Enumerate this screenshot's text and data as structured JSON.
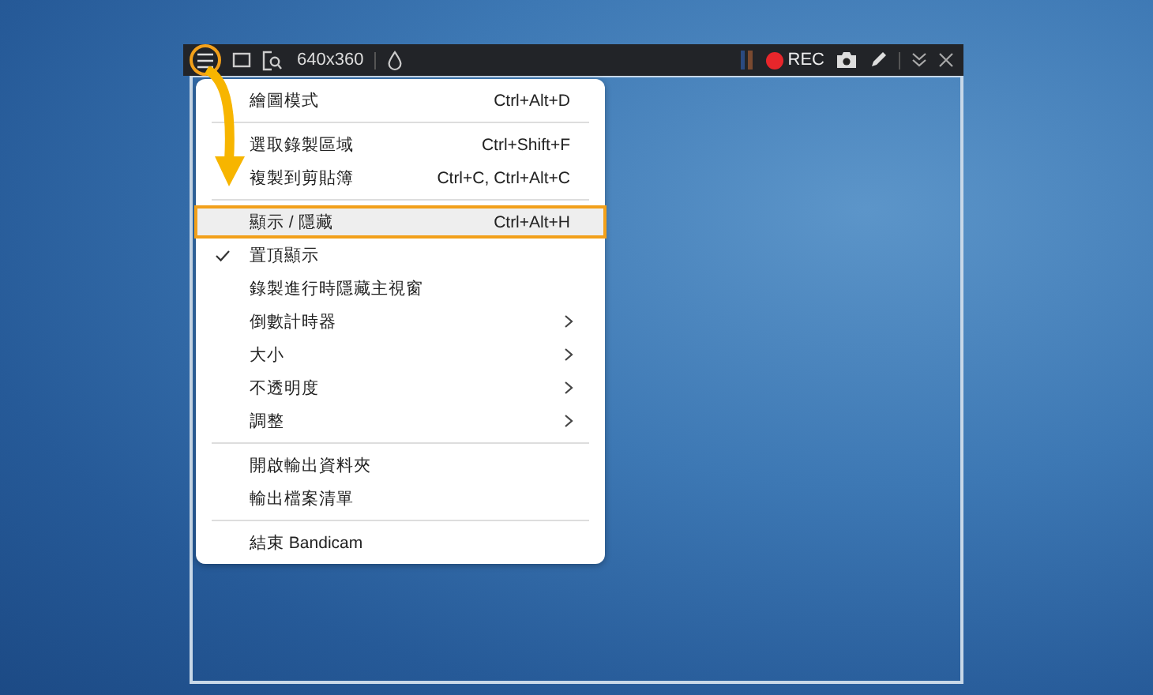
{
  "toolbar": {
    "menu_button_selected": true,
    "resolution": "640x360",
    "rec_label": "REC"
  },
  "menu": {
    "items": [
      {
        "kind": "item",
        "label": "繪圖模式",
        "shortcut": "Ctrl+Alt+D",
        "checked": false,
        "submenu": false,
        "selected": false
      },
      {
        "kind": "separator"
      },
      {
        "kind": "item",
        "label": "選取錄製區域",
        "shortcut": "Ctrl+Shift+F",
        "checked": false,
        "submenu": false,
        "selected": false
      },
      {
        "kind": "item",
        "label": "複製到剪貼簿",
        "shortcut": "Ctrl+C, Ctrl+Alt+C",
        "checked": false,
        "submenu": false,
        "selected": false
      },
      {
        "kind": "separator"
      },
      {
        "kind": "item",
        "label": "顯示 / 隱藏",
        "shortcut": "Ctrl+Alt+H",
        "checked": false,
        "submenu": false,
        "selected": true
      },
      {
        "kind": "item",
        "label": "置頂顯示",
        "checked": true,
        "submenu": false,
        "selected": false
      },
      {
        "kind": "item",
        "label": "錄製進行時隱藏主視窗",
        "checked": false,
        "submenu": false,
        "selected": false
      },
      {
        "kind": "item",
        "label": "倒數計時器",
        "checked": false,
        "submenu": true,
        "selected": false
      },
      {
        "kind": "item",
        "label": "大小",
        "checked": false,
        "submenu": true,
        "selected": false
      },
      {
        "kind": "item",
        "label": "不透明度",
        "checked": false,
        "submenu": true,
        "selected": false
      },
      {
        "kind": "item",
        "label": "調整",
        "checked": false,
        "submenu": true,
        "selected": false
      },
      {
        "kind": "separator"
      },
      {
        "kind": "item",
        "label": "開啟輸出資料夾",
        "checked": false,
        "submenu": false,
        "selected": false
      },
      {
        "kind": "item",
        "label": "輸出檔案清單",
        "checked": false,
        "submenu": false,
        "selected": false
      },
      {
        "kind": "separator"
      },
      {
        "kind": "item",
        "label": "結束 Bandicam",
        "checked": false,
        "submenu": false,
        "selected": false
      }
    ]
  }
}
